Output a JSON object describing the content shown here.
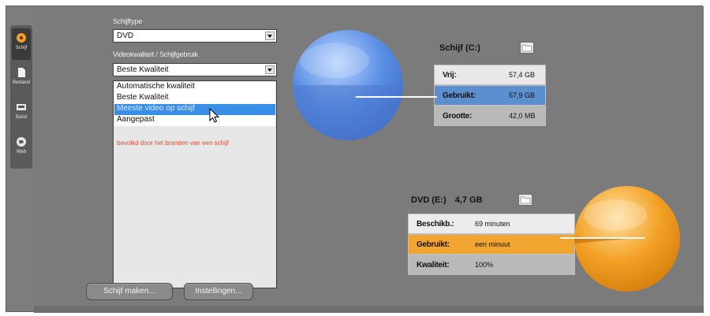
{
  "sidebar": {
    "items": [
      {
        "label": "Schijf",
        "icon": "disc-icon",
        "active": true
      },
      {
        "label": "Bestand",
        "icon": "file-icon",
        "active": false
      },
      {
        "label": "Band",
        "icon": "tape-icon",
        "active": false
      },
      {
        "label": "Web",
        "icon": "globe-icon",
        "active": false
      }
    ]
  },
  "disc_type": {
    "label": "Schijftype",
    "value": "DVD"
  },
  "quality": {
    "label": "Videokwaliteit / Schijfgebruik",
    "value": "Beste Kwaliteit",
    "options": [
      {
        "label": "Automatische kwaliteit"
      },
      {
        "label": "Beste Kwaliteit"
      },
      {
        "label": "Meeste video op schijf",
        "selected": true
      },
      {
        "label": "Aangepast"
      }
    ],
    "info": "bevolkd door het branden van een schijf"
  },
  "buttons": {
    "make_disc": "Schijf maken...",
    "settings": "Instellingen..."
  },
  "drive_c": {
    "title": "Schijf (C:)",
    "rows": [
      {
        "key": "Vrij:",
        "value": "57,4 GB",
        "bg": "#e9e9e9"
      },
      {
        "key": "Gebruikt:",
        "value": "57,9 GB",
        "bg": "#5b8fd0"
      },
      {
        "key": "Grootte:",
        "value": "42,0 MB",
        "bg": "#b9b9b9"
      }
    ],
    "pie_color": "#5b8fe4",
    "used_fraction": 0.5
  },
  "dvd": {
    "title": "DVD (E:)",
    "capacity": "4,7 GB",
    "rows": [
      {
        "key": "Beschikb.:",
        "value": "69 minuten",
        "bg": "#ececec"
      },
      {
        "key": "Gebruikt:",
        "value": "een minuut",
        "bg": "#f2a531"
      },
      {
        "key": "Kwaliteit:",
        "value": "100%",
        "bg": "#b9b9b9"
      }
    ],
    "pie_color": "#f3a125",
    "used_fraction": 0.02
  }
}
